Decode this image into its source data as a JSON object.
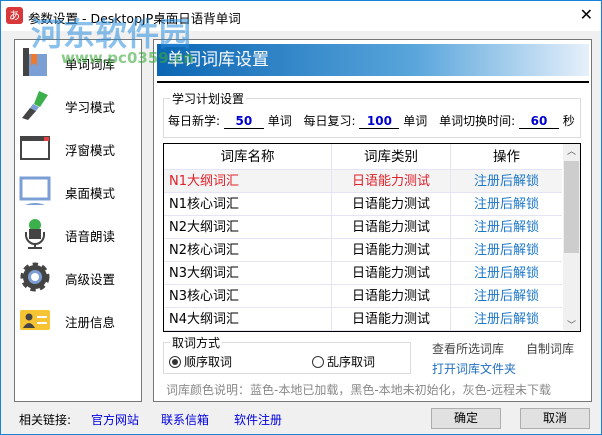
{
  "window": {
    "title": "参数设置 - DesktopJP桌面日语背单词",
    "app_icon": "あ",
    "close": "✕"
  },
  "watermark": {
    "text": "河东软件园",
    "url": "www.pc0359.cn"
  },
  "sidebar": {
    "items": [
      {
        "label": "单词词库",
        "icon": "book-icon"
      },
      {
        "label": "学习模式",
        "icon": "brush-icon"
      },
      {
        "label": "浮窗模式",
        "icon": "window-icon"
      },
      {
        "label": "桌面模式",
        "icon": "monitor-icon"
      },
      {
        "label": "语音朗读",
        "icon": "microphone-icon"
      },
      {
        "label": "高级设置",
        "icon": "gear-icon"
      },
      {
        "label": "注册信息",
        "icon": "id-card-icon"
      }
    ]
  },
  "main": {
    "header": "单词词库设置",
    "plan": {
      "title": "学习计划设置",
      "new_label": "每日新学:",
      "new_value": "50",
      "new_unit": "单词",
      "review_label": "每日复习:",
      "review_value": "100",
      "review_unit": "单词",
      "switch_label": "单词切换时间:",
      "switch_value": "60",
      "switch_unit": "秒"
    },
    "table": {
      "columns": [
        "词库名称",
        "词库类别",
        "操作"
      ],
      "rows": [
        {
          "name": "N1大纲词汇",
          "category": "日语能力测试",
          "action": "注册后解锁"
        },
        {
          "name": "N1核心词汇",
          "category": "日语能力测试",
          "action": "注册后解锁"
        },
        {
          "name": "N2大纲词汇",
          "category": "日语能力测试",
          "action": "注册后解锁"
        },
        {
          "name": "N2核心词汇",
          "category": "日语能力测试",
          "action": "注册后解锁"
        },
        {
          "name": "N3大纲词汇",
          "category": "日语能力测试",
          "action": "注册后解锁"
        },
        {
          "name": "N3核心词汇",
          "category": "日语能力测试",
          "action": "注册后解锁"
        },
        {
          "name": "N4大纲词汇",
          "category": "日语能力测试",
          "action": "注册后解锁"
        }
      ]
    },
    "pick": {
      "title": "取词方式",
      "opt1": "顺序取词",
      "opt2": "乱序取词"
    },
    "view_selected": "查看所选词库",
    "custom": "自制词库",
    "open_folder": "打开词库文件夹",
    "legend": "词库颜色说明：蓝色-本地已加载，黑色-本地未初始化，灰色-远程未下载"
  },
  "footer": {
    "label": "相关链接:",
    "links": [
      "官方网站",
      "联系信箱",
      "软件注册"
    ],
    "ok": "确定",
    "cancel": "取消"
  },
  "colors": {
    "selected": "#e0202a",
    "action": "#1e78c8",
    "accent": "#0b66b3"
  }
}
